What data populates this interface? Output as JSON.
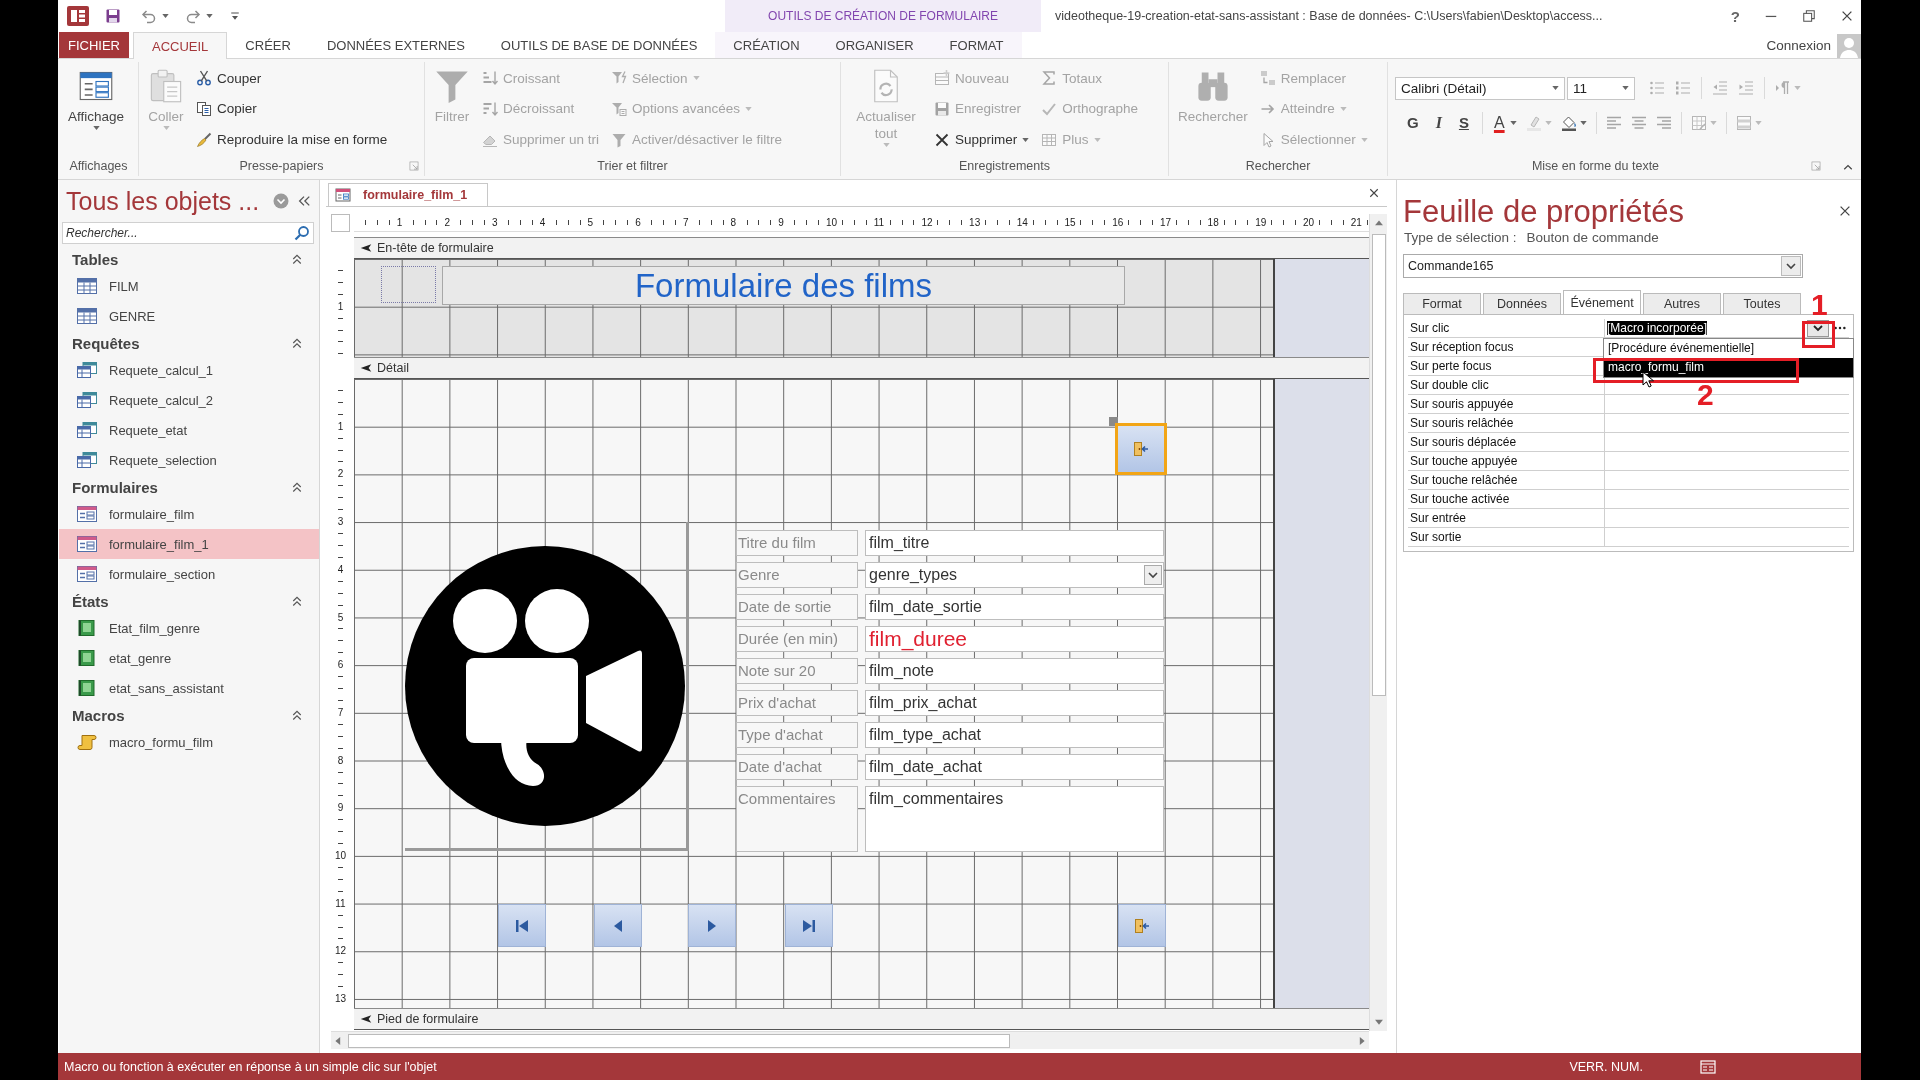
{
  "title_bar": {
    "contextual_header": "OUTILS DE CRÉATION DE FORMULAIRE",
    "title": "videotheque-19-creation-etat-sans-assistant : Base de données- C:\\Users\\fabien\\Desktop\\access...",
    "help": "?"
  },
  "ribbon_tabs": [
    {
      "label": "FICHIER",
      "kind": "file",
      "selected": false
    },
    {
      "label": "ACCUEIL",
      "kind": "tab",
      "selected": true
    },
    {
      "label": "CRÉER",
      "kind": "tab",
      "selected": false
    },
    {
      "label": "DONNÉES EXTERNES",
      "kind": "tab",
      "selected": false
    },
    {
      "label": "OUTILS DE BASE DE DONNÉES",
      "kind": "tab",
      "selected": false
    },
    {
      "label": "CRÉATION",
      "kind": "contextual",
      "selected": false
    },
    {
      "label": "ORGANISER",
      "kind": "contextual",
      "selected": false
    },
    {
      "label": "FORMAT",
      "kind": "contextual",
      "selected": false
    }
  ],
  "account": {
    "label": "Connexion"
  },
  "ribbon": {
    "groups": [
      {
        "label": "Affichages",
        "large": [
          {
            "label": "Affichage",
            "disabled": false,
            "dropdown": true
          }
        ]
      },
      {
        "label": "Presse-papiers",
        "launcher": true,
        "large": [
          {
            "label": "Coller",
            "disabled": true,
            "dropdown": true
          }
        ],
        "columns": [
          [
            {
              "label": "Couper",
              "disabled": false
            },
            {
              "label": "Copier",
              "disabled": false
            },
            {
              "label": "Reproduire la mise en forme",
              "disabled": false
            }
          ]
        ]
      },
      {
        "label": "Trier et filtrer",
        "large": [
          {
            "label": "Filtrer",
            "disabled": true
          }
        ],
        "columns": [
          [
            {
              "label": "Croissant",
              "disabled": true
            },
            {
              "label": "Décroissant",
              "disabled": true
            },
            {
              "label": "Supprimer un tri",
              "disabled": true
            }
          ],
          [
            {
              "label": "Sélection",
              "disabled": true,
              "dropdown": true
            },
            {
              "label": "Options avancées",
              "disabled": true,
              "dropdown": true
            },
            {
              "label": "Activer/désactiver le filtre",
              "disabled": true
            }
          ]
        ]
      },
      {
        "label": "Enregistrements",
        "large": [
          {
            "label": "Actualiser tout",
            "disabled": true,
            "dropdown": true
          }
        ],
        "columns": [
          [
            {
              "label": "Nouveau",
              "disabled": true
            },
            {
              "label": "Enregistrer",
              "disabled": true
            },
            {
              "label": "Supprimer",
              "disabled": false,
              "dropdown": true
            }
          ],
          [
            {
              "label": "Totaux",
              "disabled": true
            },
            {
              "label": "Orthographe",
              "disabled": true
            },
            {
              "label": "Plus",
              "disabled": true,
              "dropdown": true
            }
          ]
        ]
      },
      {
        "label": "Rechercher",
        "large": [
          {
            "label": "Rechercher",
            "disabled": true
          }
        ],
        "columns": [
          [
            {
              "label": "Remplacer",
              "disabled": true
            },
            {
              "label": "Atteindre",
              "disabled": true,
              "dropdown": true
            },
            {
              "label": "Sélectionner",
              "disabled": true,
              "dropdown": true
            }
          ]
        ]
      }
    ],
    "text_format": {
      "label": "Mise en forme du texte",
      "launcher": true,
      "font": "Calibri (Détail)",
      "size": "11",
      "list_tools": [
        {
          "disabled": true
        },
        {
          "disabled": true
        },
        {
          "disabled": true
        },
        {
          "disabled": true
        },
        {
          "disabled": true,
          "dropdown": true
        }
      ],
      "style_buttons": [
        {
          "label": "G",
          "disabled": false
        },
        {
          "label": "I",
          "disabled": false
        },
        {
          "label": "S",
          "disabled": false
        }
      ],
      "font_color": {
        "label": "A",
        "disabled": false,
        "dropdown": true
      },
      "color_tools": [
        {
          "disabled": true,
          "dropdown": true
        },
        {
          "disabled": false,
          "dropdown": true
        }
      ],
      "align_tools": [
        {
          "disabled": true
        },
        {
          "disabled": true
        },
        {
          "disabled": true
        }
      ],
      "table_tools": [
        {
          "disabled": true,
          "dropdown": true
        },
        {
          "disabled": true,
          "dropdown": true
        }
      ]
    }
  },
  "navigation": {
    "title": "Tous les objets ...",
    "search_placeholder": "Rechercher...",
    "groups": [
      {
        "label": "Tables",
        "kind": "table",
        "expanded": true,
        "items": [
          {
            "label": "FILM",
            "selected": false
          },
          {
            "label": "GENRE",
            "selected": false
          }
        ]
      },
      {
        "label": "Requêtes",
        "kind": "query",
        "expanded": true,
        "items": [
          {
            "label": "Requete_calcul_1",
            "selected": false
          },
          {
            "label": "Requete_calcul_2",
            "selected": false
          },
          {
            "label": "Requete_etat",
            "selected": false
          },
          {
            "label": "Requete_selection",
            "selected": false
          }
        ]
      },
      {
        "label": "Formulaires",
        "kind": "form",
        "expanded": true,
        "items": [
          {
            "label": "formulaire_film",
            "selected": false
          },
          {
            "label": "formulaire_film_1",
            "selected": true
          },
          {
            "label": "formulaire_section",
            "selected": false
          }
        ]
      },
      {
        "label": "États",
        "kind": "report",
        "expanded": true,
        "items": [
          {
            "label": "Etat_film_genre",
            "selected": false
          },
          {
            "label": "etat_genre",
            "selected": false
          },
          {
            "label": "etat_sans_assistant",
            "selected": false
          }
        ]
      },
      {
        "label": "Macros",
        "kind": "macro",
        "expanded": true,
        "items": [
          {
            "label": "macro_formu_film",
            "selected": false
          }
        ]
      }
    ]
  },
  "document": {
    "tabs": [
      {
        "label": "formulaire_film_1",
        "selected": true
      }
    ],
    "ruler": [
      "1",
      "2",
      "3",
      "4",
      "5",
      "6",
      "7",
      "8",
      "9",
      "10",
      "11",
      "12",
      "13",
      "14",
      "15",
      "16",
      "17",
      "18",
      "19",
      "20",
      "21"
    ],
    "sections": [
      {
        "label": "En-tête de formulaire",
        "kind": "header",
        "ruler": [
          "1"
        ],
        "title": "Formulaire des films"
      },
      {
        "label": "Détail",
        "kind": "detail",
        "ruler": [
          "1",
          "2",
          "3",
          "4",
          "5",
          "6",
          "7",
          "8",
          "9",
          "10",
          "11",
          "12",
          "13"
        ],
        "fields": [
          {
            "label": "Titre du film",
            "value": "film_titre",
            "kind": "text",
            "selected": false
          },
          {
            "label": "Genre",
            "value": "genre_types",
            "kind": "combo",
            "selected": false
          },
          {
            "label": "Date de sortie",
            "value": "film_date_sortie",
            "kind": "text",
            "selected": false
          },
          {
            "label": "Durée (en min)",
            "value": "film_duree",
            "kind": "accent",
            "selected": false
          },
          {
            "label": "Note sur 20",
            "value": "film_note",
            "kind": "text",
            "selected": false
          },
          {
            "label": "Prix d'achat",
            "value": "film_prix_achat",
            "kind": "text",
            "selected": false
          },
          {
            "label": "Type d'achat",
            "value": "film_type_achat",
            "kind": "text",
            "selected": false
          },
          {
            "label": "Date d'achat",
            "value": "film_date_achat",
            "kind": "text",
            "selected": false
          },
          {
            "label": "Commentaires",
            "value": "film_commentaires",
            "kind": "memo",
            "selected": false
          }
        ],
        "buttons": [
          {
            "selected": true
          },
          {
            "selected": false
          },
          {
            "selected": false
          },
          {
            "selected": false
          },
          {
            "selected": false
          },
          {
            "selected": false
          }
        ]
      },
      {
        "label": "Pied de formulaire",
        "kind": "footer"
      }
    ]
  },
  "property_sheet": {
    "title": "Feuille de propriétés",
    "selection_label": "Type de sélection :",
    "selection_type": "Bouton de commande",
    "object": "Commande165",
    "tabs": [
      {
        "label": "Format",
        "selected": false
      },
      {
        "label": "Données",
        "selected": false
      },
      {
        "label": "Événement",
        "selected": true
      },
      {
        "label": "Autres",
        "selected": false
      },
      {
        "label": "Toutes",
        "selected": false
      }
    ],
    "properties": [
      {
        "name": "Sur clic",
        "value": "[Macro incorporée]",
        "selected": true
      },
      {
        "name": "Sur réception focus",
        "selected": false
      },
      {
        "name": "Sur perte focus",
        "selected": false
      },
      {
        "name": "Sur double clic",
        "selected": false
      },
      {
        "name": "Sur souris appuyée",
        "selected": false
      },
      {
        "name": "Sur souris relâchée",
        "selected": false
      },
      {
        "name": "Sur souris déplacée",
        "selected": false
      },
      {
        "name": "Sur touche appuyée",
        "selected": false
      },
      {
        "name": "Sur touche relâchée",
        "selected": false
      },
      {
        "name": "Sur touche activée",
        "selected": false
      },
      {
        "name": "Sur entrée",
        "selected": false
      },
      {
        "name": "Sur sortie",
        "selected": false
      }
    ],
    "dropdown": {
      "open": true,
      "options": [
        {
          "label": "[Procédure événementielle]",
          "selected": false
        },
        {
          "label": "macro_formu_film",
          "selected": true
        }
      ]
    },
    "callouts": [
      {
        "label": "1"
      },
      {
        "label": "2"
      }
    ]
  },
  "status_bar": {
    "message": "Macro ou fonction à exécuter en réponse à un simple clic sur l'objet",
    "indicator": "VERR. NUM."
  }
}
